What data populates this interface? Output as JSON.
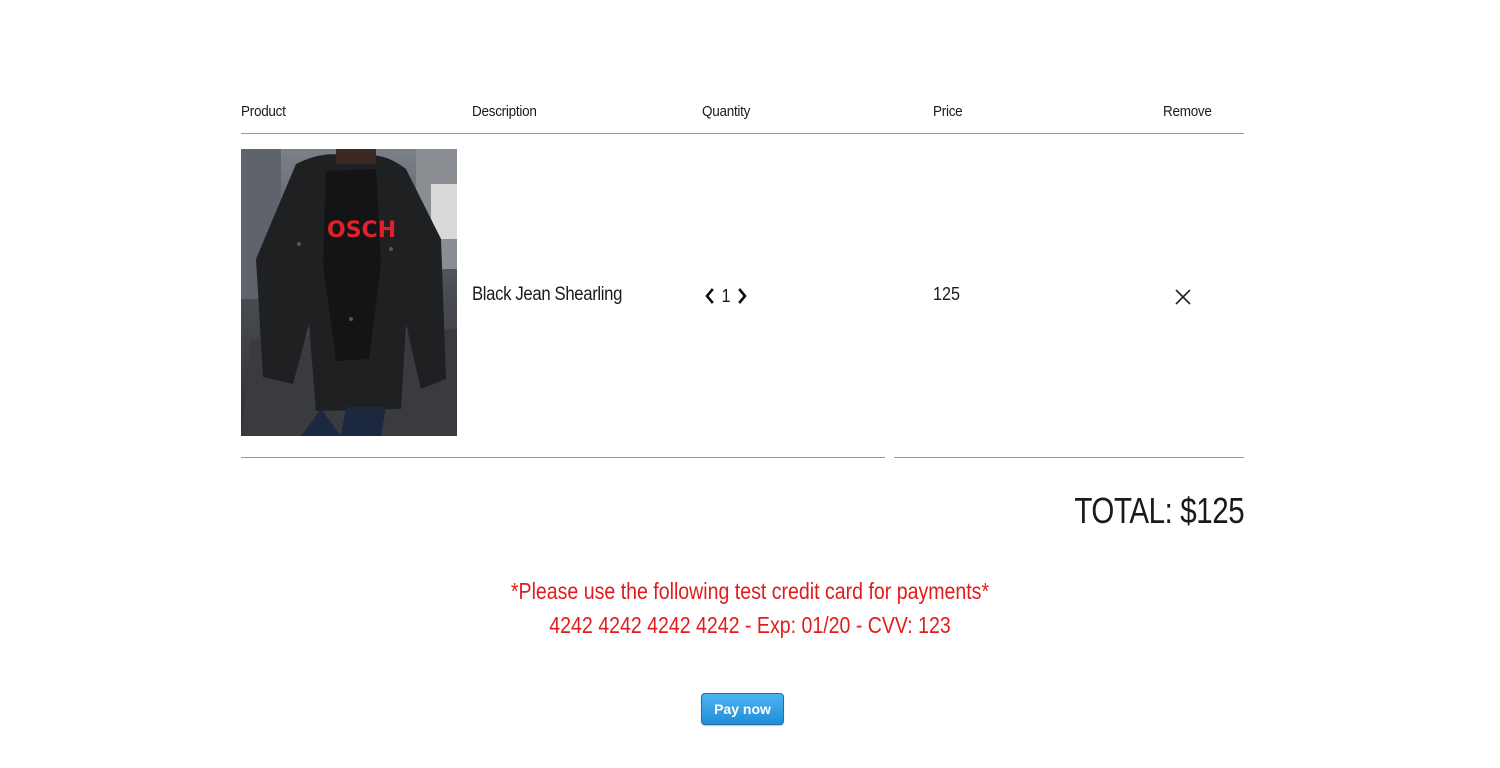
{
  "cart": {
    "headers": {
      "product": "Product",
      "description": "Description",
      "quantity": "Quantity",
      "price": "Price",
      "remove": "Remove"
    },
    "items": [
      {
        "image_icon": "jacket-photo",
        "description": "Black Jean Shearling",
        "quantity": "1",
        "price": "125",
        "decrement_icon": "chevron-left-icon",
        "increment_icon": "chevron-right-icon",
        "remove_icon": "close-icon"
      }
    ],
    "total": "TOTAL: $125"
  },
  "notice": {
    "line1": "*Please use the following test credit card for payments*",
    "line2": "4242 4242 4242 4242 - Exp: 01/20 - CVV: 123",
    "color": "#e21c1c"
  },
  "pay_button": {
    "label": "Pay now",
    "color": "#2a9ae2"
  }
}
